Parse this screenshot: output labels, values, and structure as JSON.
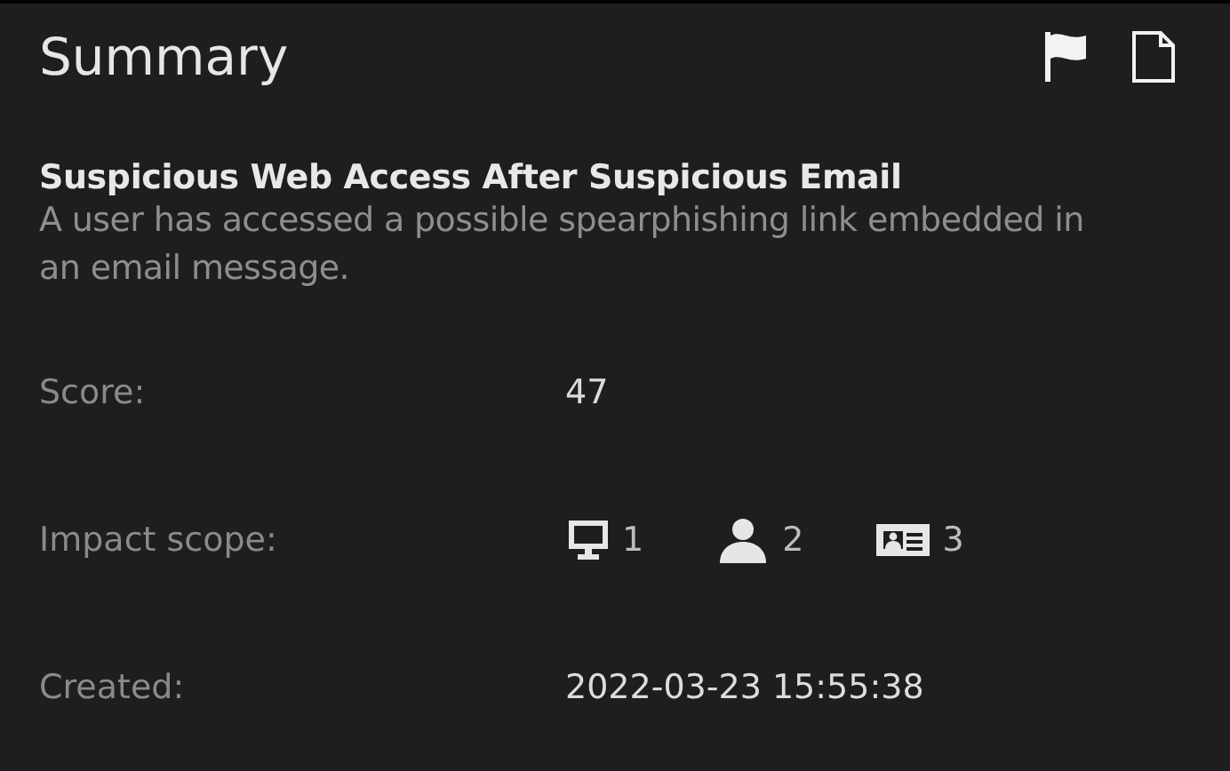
{
  "panel": {
    "title": "Summary"
  },
  "alert": {
    "name": "Suspicious Web Access After Suspicious Email",
    "description": "A user has accessed a possible spearphishing link embedded in an email message."
  },
  "fields": [
    {
      "kind": "text",
      "label": "Score:",
      "value": "47"
    },
    {
      "kind": "scope",
      "label": "Impact scope:",
      "items": [
        {
          "kind": "device",
          "count": "1"
        },
        {
          "kind": "user",
          "count": "2"
        },
        {
          "kind": "account",
          "count": "3"
        }
      ]
    },
    {
      "kind": "text",
      "label": "Created:",
      "value": "2022-03-23 15:55:38"
    }
  ]
}
